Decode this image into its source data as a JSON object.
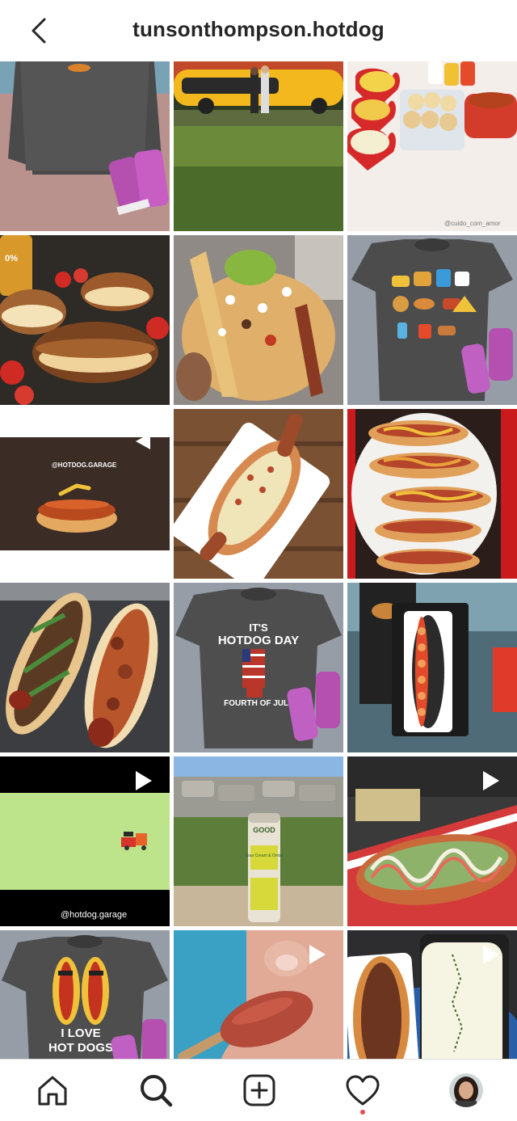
{
  "header": {
    "username": "tunsonthompson.hotdog",
    "back_icon": "chevron-left-icon"
  },
  "grid": {
    "tiles": [
      {
        "desc_id": "tile-1",
        "kind": "image"
      },
      {
        "desc_id": "tile-2",
        "kind": "image"
      },
      {
        "desc_id": "tile-3",
        "kind": "image",
        "caption": "@cuido_com_amor"
      },
      {
        "desc_id": "tile-4",
        "kind": "image",
        "jar_text": "0%"
      },
      {
        "desc_id": "tile-5",
        "kind": "image"
      },
      {
        "desc_id": "tile-6",
        "kind": "image"
      },
      {
        "desc_id": "tile-7",
        "kind": "video",
        "watermark": "@HOTDOG.GARAGE"
      },
      {
        "desc_id": "tile-8",
        "kind": "image"
      },
      {
        "desc_id": "tile-9",
        "kind": "image"
      },
      {
        "desc_id": "tile-10",
        "kind": "image"
      },
      {
        "desc_id": "tile-11",
        "kind": "image",
        "shirt_line1": "IT'S",
        "shirt_line2": "HOTDOG DAY",
        "shirt_line3": "FOURTH OF JULY"
      },
      {
        "desc_id": "tile-12",
        "kind": "image"
      },
      {
        "desc_id": "tile-13",
        "kind": "video",
        "watermark": "@hotdog.garage"
      },
      {
        "desc_id": "tile-14",
        "kind": "image",
        "can_brand": "GOOD",
        "can_flavor": "Sour Cream & Onion"
      },
      {
        "desc_id": "tile-15",
        "kind": "video"
      },
      {
        "desc_id": "tile-16",
        "kind": "image",
        "shirt_line1": "I LOVE",
        "shirt_line2": "HOT DOGS"
      },
      {
        "desc_id": "tile-17",
        "kind": "video"
      },
      {
        "desc_id": "tile-18",
        "kind": "video"
      }
    ]
  },
  "tabbar": {
    "home_icon": "home-icon",
    "search_icon": "search-icon",
    "new_post_icon": "plus-square-icon",
    "activity_icon": "heart-icon",
    "profile_icon": "avatar"
  },
  "colors": {
    "text": "#262626",
    "notification_dot": "#ed4956",
    "separator": "#dbdbdb"
  }
}
